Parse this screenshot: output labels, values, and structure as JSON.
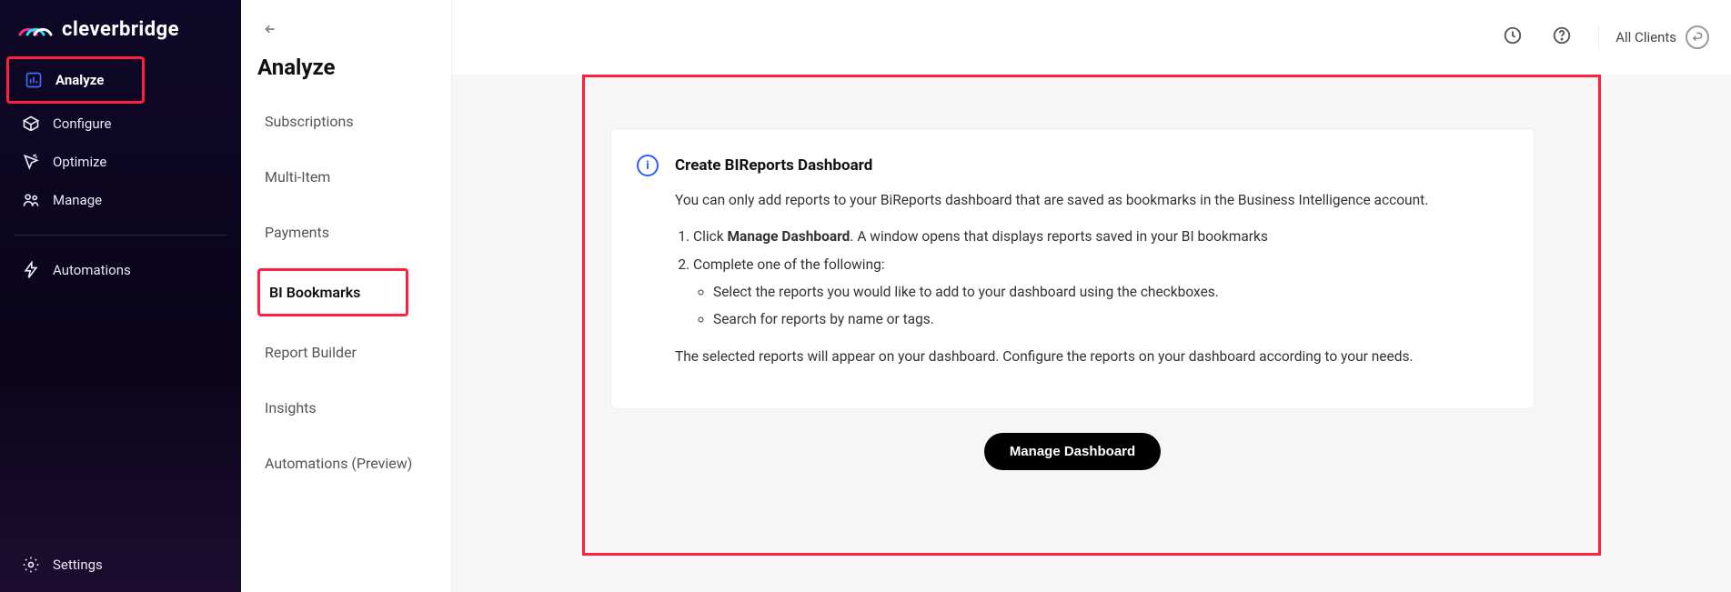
{
  "brand": "cleverbridge",
  "primary_nav": {
    "analyze": "Analyze",
    "configure": "Configure",
    "optimize": "Optimize",
    "manage": "Manage",
    "automations": "Automations",
    "settings": "Settings"
  },
  "secondary": {
    "title": "Analyze",
    "items": {
      "subscriptions": "Subscriptions",
      "multi_item": "Multi-Item",
      "payments": "Payments",
      "bi_bookmarks": "BI Bookmarks",
      "report_builder": "Report Builder",
      "insights": "Insights",
      "automations_preview": "Automations (Preview)"
    }
  },
  "topbar": {
    "all_clients": "All Clients"
  },
  "info": {
    "icon_char": "i",
    "title": "Create BIReports Dashboard",
    "intro": "You can only add reports to your BiReports dashboard that are saved as bookmarks in the Business Intelligence account.",
    "step1_prefix": "Click ",
    "step1_bold": "Manage Dashboard",
    "step1_suffix": ". A window opens that displays reports saved in your BI bookmarks",
    "step2": "Complete one of the following:",
    "sub_a": "Select the reports you would like to add to your dashboard using the checkboxes.",
    "sub_b": "Search for reports by name or tags.",
    "outro": "The selected reports will appear on your dashboard. Configure the reports on your dashboard according to your needs."
  },
  "buttons": {
    "manage_dashboard": "Manage Dashboard"
  }
}
